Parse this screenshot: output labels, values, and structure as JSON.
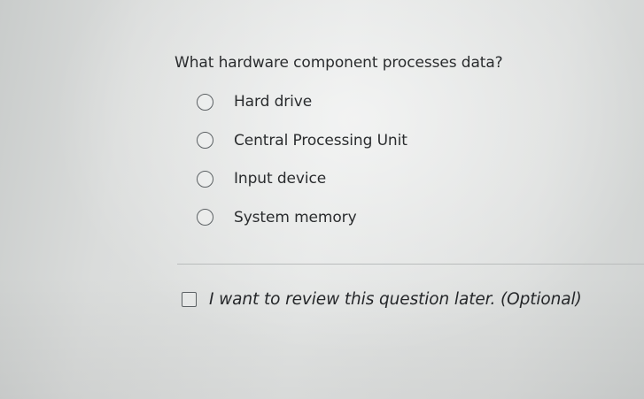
{
  "question": {
    "text": "What hardware component processes data?"
  },
  "options": [
    {
      "label": "Hard drive",
      "selected": false
    },
    {
      "label": "Central Processing Unit",
      "selected": false
    },
    {
      "label": "Input device",
      "selected": false
    },
    {
      "label": "System memory",
      "selected": false
    }
  ],
  "review": {
    "label": "I want to review this question later. (Optional)",
    "checked": false
  }
}
